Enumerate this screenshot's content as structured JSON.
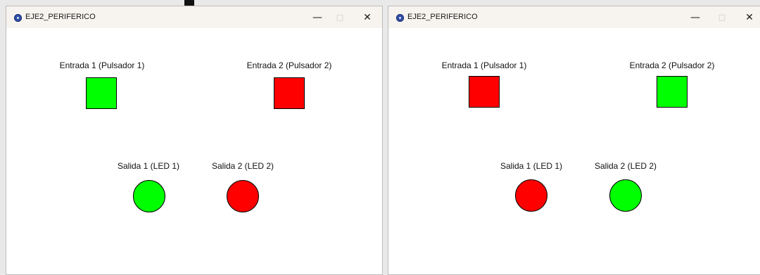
{
  "colors": {
    "on": "#00ff00",
    "off": "#ff0000"
  },
  "windows": [
    {
      "title": "EJE2_PERIFERICO",
      "controls": {
        "minimize": "—",
        "maximize": "□",
        "close": "✕"
      },
      "inputs": [
        {
          "label": "Entrada 1 (Pulsador 1)",
          "state": "on",
          "color": "#00ff00"
        },
        {
          "label": "Entrada 2 (Pulsador 2)",
          "state": "off",
          "color": "#ff0000"
        }
      ],
      "outputs": [
        {
          "label": "Salida 1 (LED 1)",
          "state": "on",
          "color": "#00ff00"
        },
        {
          "label": "Salida 2 (LED 2)",
          "state": "off",
          "color": "#ff0000"
        }
      ]
    },
    {
      "title": "EJE2_PERIFERICO",
      "controls": {
        "minimize": "—",
        "maximize": "□",
        "close": "✕"
      },
      "inputs": [
        {
          "label": "Entrada 1 (Pulsador 1)",
          "state": "off",
          "color": "#ff0000"
        },
        {
          "label": "Entrada 2 (Pulsador 2)",
          "state": "on",
          "color": "#00ff00"
        }
      ],
      "outputs": [
        {
          "label": "Salida 1 (LED 1)",
          "state": "off",
          "color": "#ff0000"
        },
        {
          "label": "Salida 2 (LED 2)",
          "state": "on",
          "color": "#00ff00"
        }
      ]
    }
  ]
}
